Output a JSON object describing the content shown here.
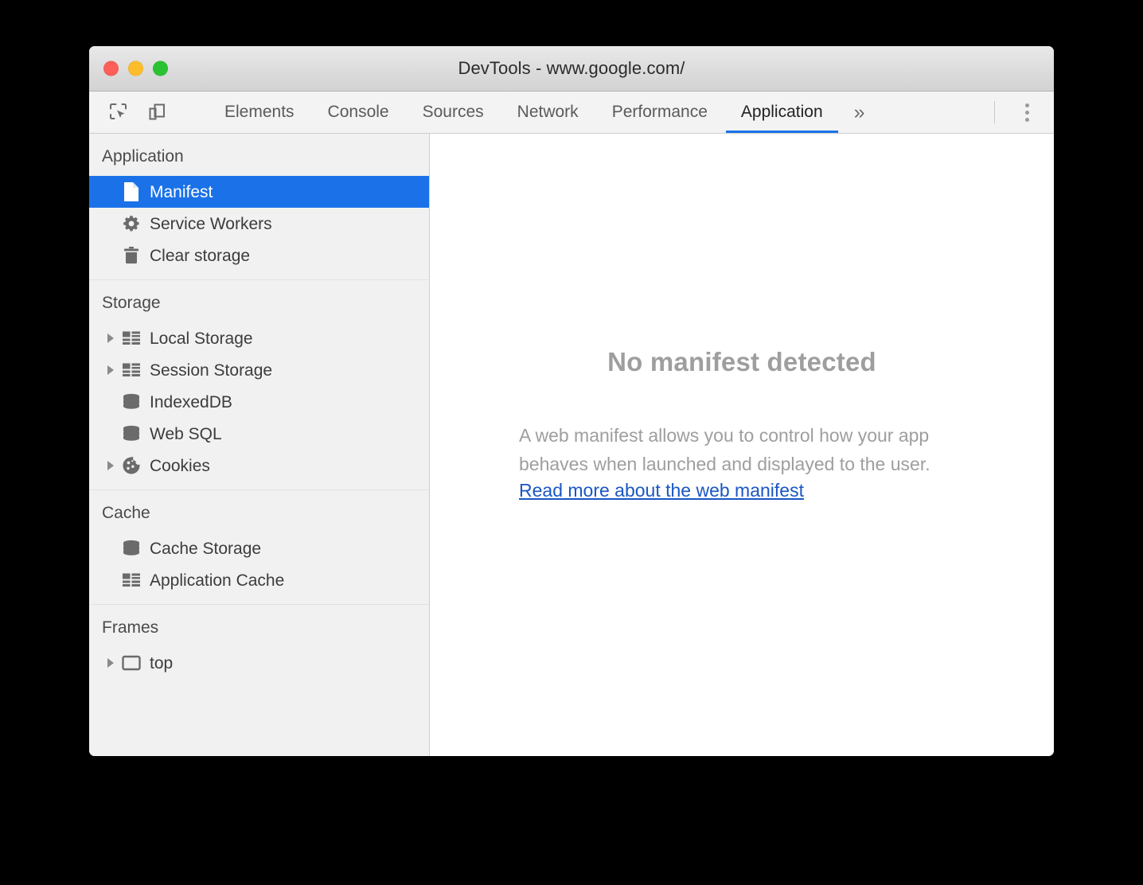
{
  "window": {
    "title": "DevTools - www.google.com/",
    "traffic_lights": [
      {
        "name": "close",
        "color": "#fc5f57"
      },
      {
        "name": "minimize",
        "color": "#fcbd2c"
      },
      {
        "name": "zoom",
        "color": "#2ac231"
      }
    ]
  },
  "toolbar": {
    "inspect_icon": "inspect-element-icon",
    "device_toggle_icon": "device-toolbar-icon",
    "more_tabs_label": "»",
    "menu_icon": "kebab-menu-icon",
    "tabs": [
      {
        "label": "Elements",
        "active": false
      },
      {
        "label": "Console",
        "active": false
      },
      {
        "label": "Sources",
        "active": false
      },
      {
        "label": "Network",
        "active": false
      },
      {
        "label": "Performance",
        "active": false
      },
      {
        "label": "Application",
        "active": true
      }
    ],
    "active_tab": "Application",
    "accent_color": "#1a73e8"
  },
  "sidebar": {
    "sections": [
      {
        "title": "Application",
        "items": [
          {
            "label": "Manifest",
            "icon": "document-icon",
            "expandable": false,
            "selected": true
          },
          {
            "label": "Service Workers",
            "icon": "gear-icon",
            "expandable": false,
            "selected": false
          },
          {
            "label": "Clear storage",
            "icon": "trash-icon",
            "expandable": false,
            "selected": false
          }
        ]
      },
      {
        "title": "Storage",
        "items": [
          {
            "label": "Local Storage",
            "icon": "table-icon",
            "expandable": true,
            "selected": false
          },
          {
            "label": "Session Storage",
            "icon": "table-icon",
            "expandable": true,
            "selected": false
          },
          {
            "label": "IndexedDB",
            "icon": "database-icon",
            "expandable": false,
            "selected": false
          },
          {
            "label": "Web SQL",
            "icon": "database-icon",
            "expandable": false,
            "selected": false
          },
          {
            "label": "Cookies",
            "icon": "cookie-icon",
            "expandable": true,
            "selected": false
          }
        ]
      },
      {
        "title": "Cache",
        "items": [
          {
            "label": "Cache Storage",
            "icon": "database-icon",
            "expandable": false,
            "selected": false
          },
          {
            "label": "Application Cache",
            "icon": "table-icon",
            "expandable": false,
            "selected": false
          }
        ]
      },
      {
        "title": "Frames",
        "items": [
          {
            "label": "top",
            "icon": "frame-icon",
            "expandable": true,
            "selected": false
          }
        ]
      }
    ],
    "selection_color": "#1b72e8",
    "background_color": "#f1f1f1"
  },
  "main": {
    "empty_title": "No manifest detected",
    "empty_description": "A web manifest allows you to control how your app behaves when launched and displayed to the user.",
    "link_label": "Read more about the web manifest",
    "link_color": "#1a56c4",
    "text_color": "#9e9e9e"
  }
}
